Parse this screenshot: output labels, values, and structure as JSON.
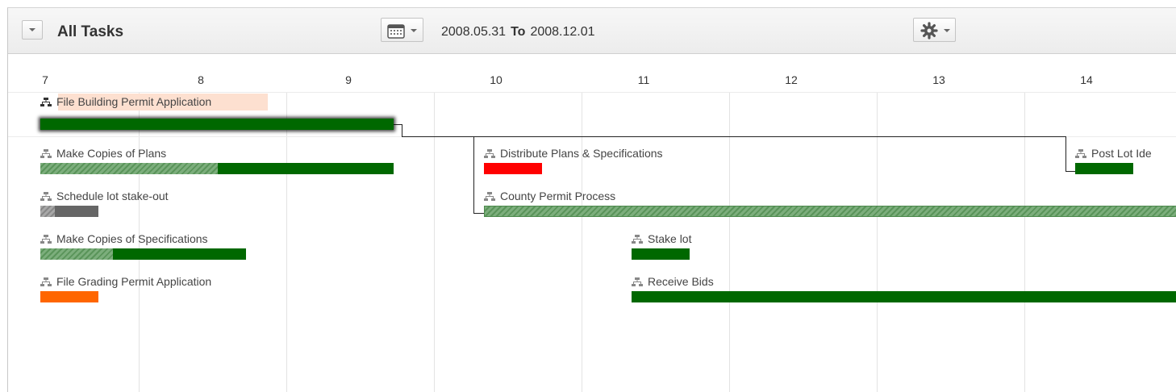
{
  "toolbar": {
    "title": "All Tasks",
    "date_from": "2008.05.31",
    "to_label": "To",
    "date_to": "2008.12.01",
    "dropdown_icon": "chevron-down-icon",
    "calendar_icon": "calendar-icon",
    "settings_icon": "gear-icon"
  },
  "timeline": {
    "days": [
      "7",
      "8",
      "9",
      "10",
      "11",
      "12",
      "13",
      "14"
    ]
  },
  "tasks": [
    {
      "id": "file-building-permit",
      "name": "File Building Permit Application",
      "color": "#006800",
      "progress": 0,
      "selected": true
    },
    {
      "id": "make-copies-plans",
      "name": "Make Copies of Plans",
      "color": "#006800",
      "progress": 0.5
    },
    {
      "id": "schedule-stakeout",
      "name": "Schedule lot stake-out",
      "color": "#666666",
      "progress": 0.25
    },
    {
      "id": "make-copies-specs",
      "name": "Make Copies of Specifications",
      "color": "#006800",
      "progress": 0.35
    },
    {
      "id": "file-grading-permit",
      "name": "File Grading Permit Application",
      "color": "#ff6600",
      "progress": 0
    },
    {
      "id": "distribute-plans",
      "name": "Distribute Plans & Specifications",
      "color": "#ff0000",
      "progress": 0
    },
    {
      "id": "county-permit",
      "name": "County Permit Process",
      "color": "#006800",
      "progress": 1.0
    },
    {
      "id": "stake-lot",
      "name": "Stake lot",
      "color": "#006800",
      "progress": 0
    },
    {
      "id": "receive-bids",
      "name": "Receive Bids",
      "color": "#006800",
      "progress": 0
    },
    {
      "id": "post-lot",
      "name": "Post Lot Ide",
      "color": "#006800",
      "progress": 0
    }
  ],
  "colors": {
    "selection_highlight": "#fde0d0",
    "task_green": "#006800",
    "task_red": "#ff0000",
    "task_orange": "#ff6600",
    "task_gray": "#666666"
  }
}
